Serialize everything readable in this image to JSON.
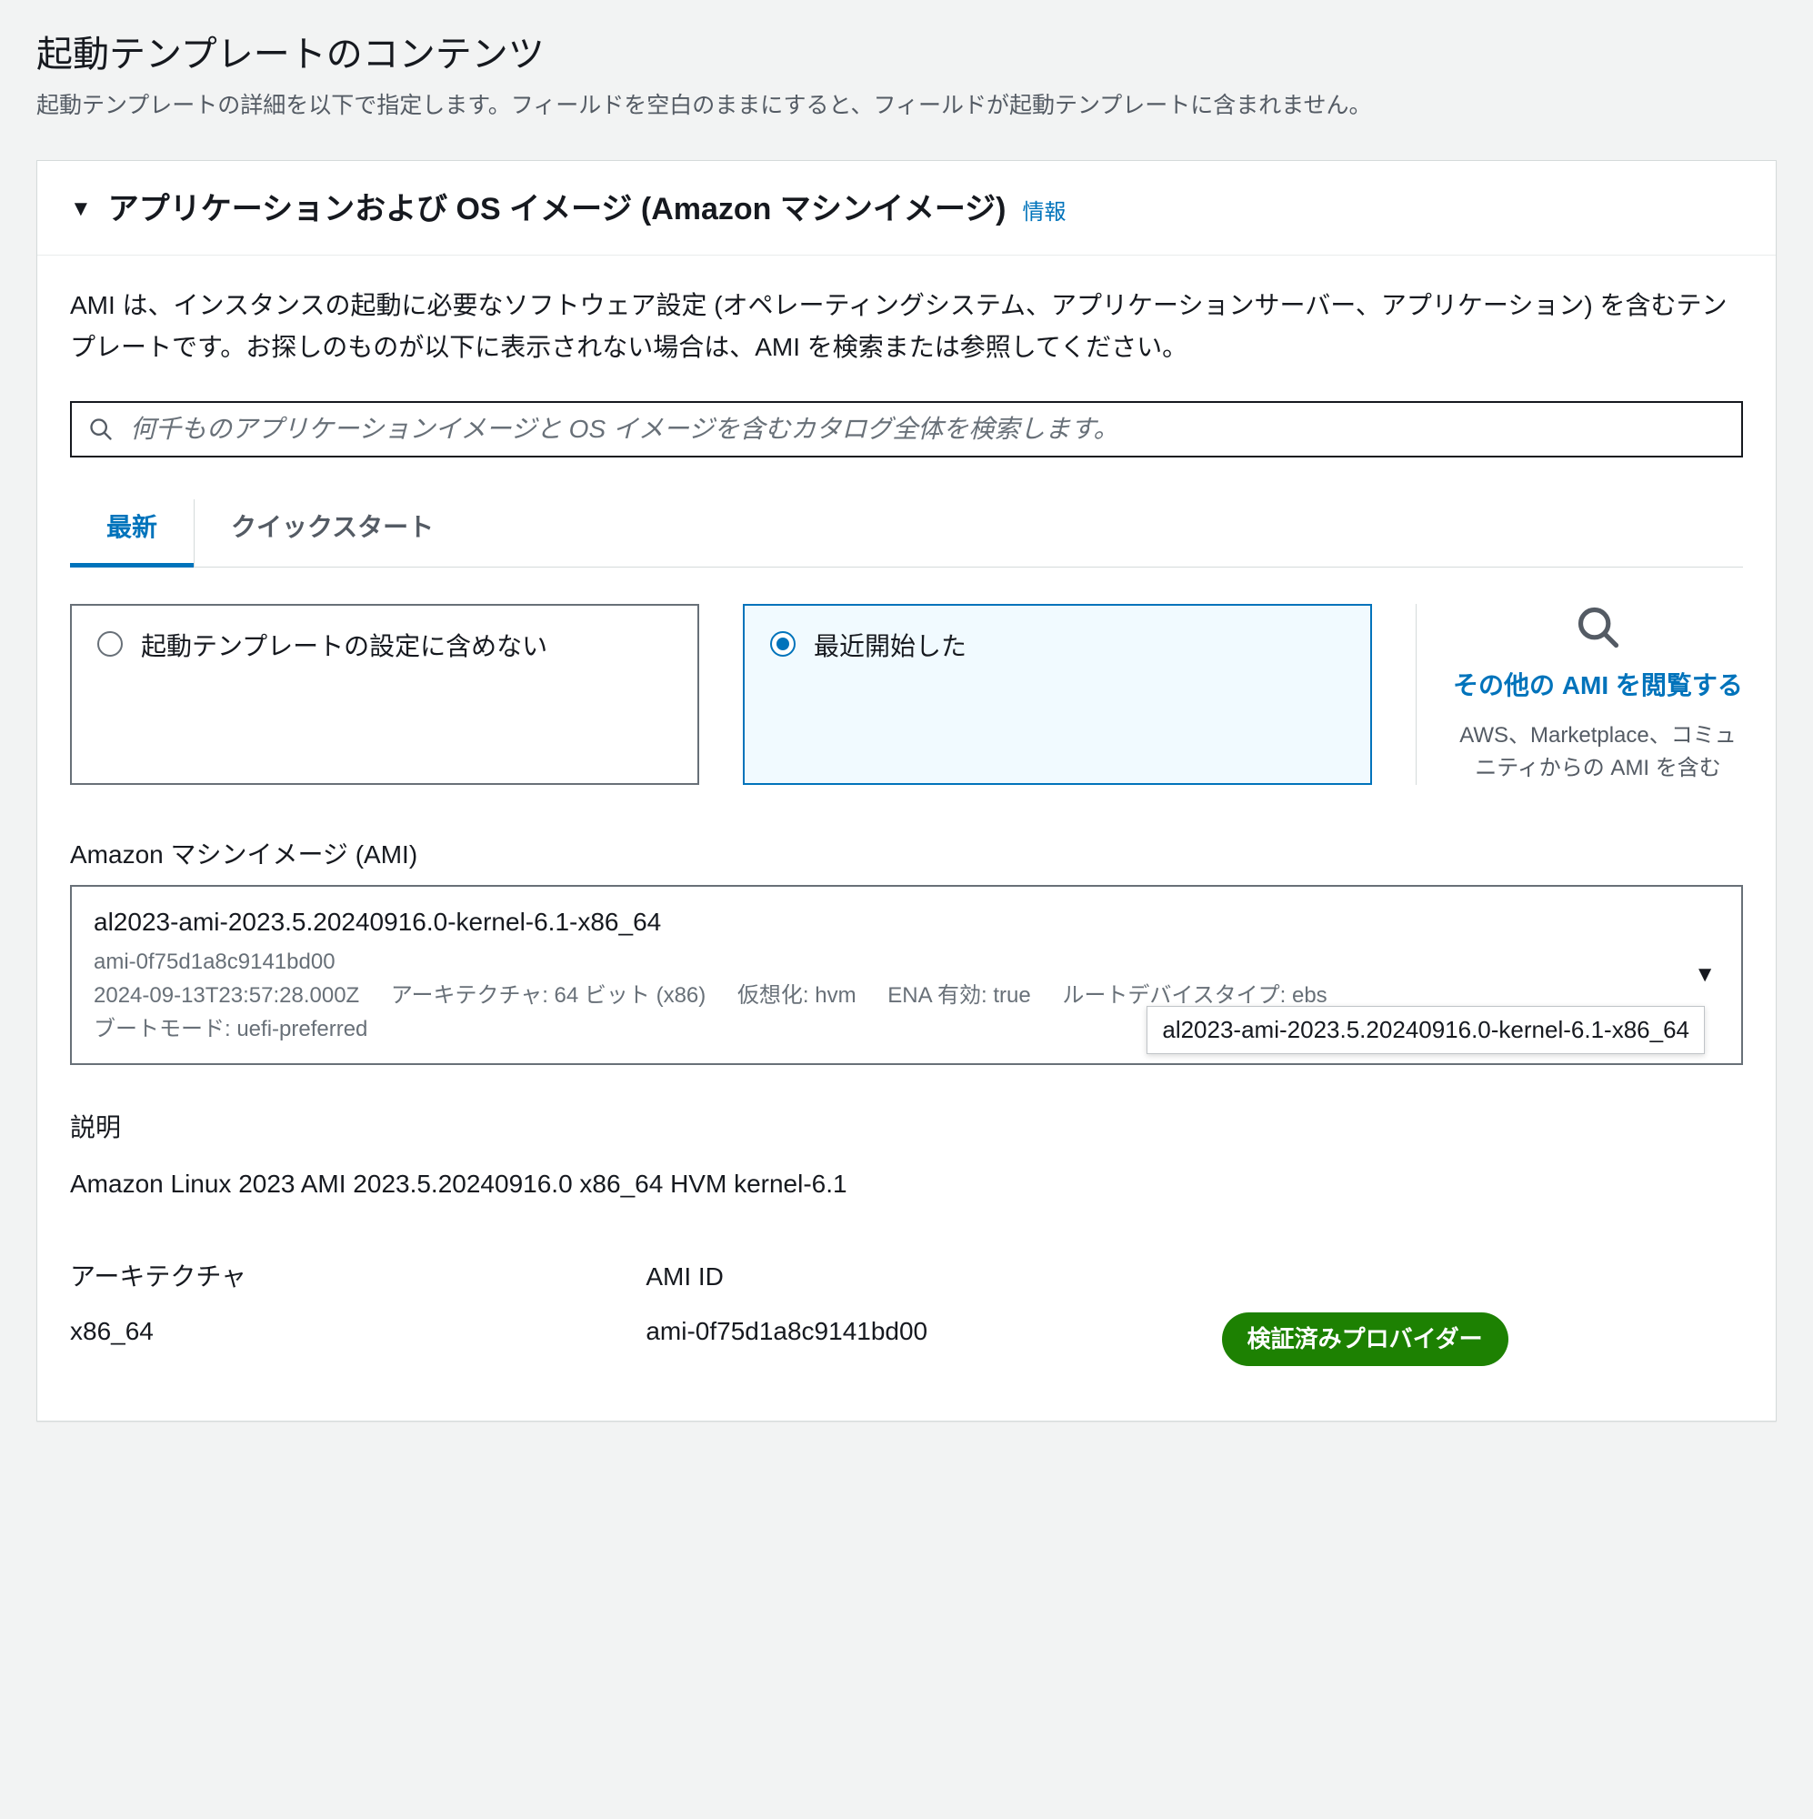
{
  "page": {
    "title": "起動テンプレートのコンテンツ",
    "subtitle": "起動テンプレートの詳細を以下で指定します。フィールドを空白のままにすると、フィールドが起動テンプレートに含まれません。"
  },
  "panel": {
    "title": "アプリケーションおよび OS イメージ (Amazon マシンイメージ)",
    "info_link": "情報",
    "description": "AMI は、インスタンスの起動に必要なソフトウェア設定 (オペレーティングシステム、アプリケーションサーバー、アプリケーション) を含むテンプレートです。お探しのものが以下に表示されない場合は、AMI を検索または参照してください。"
  },
  "search": {
    "placeholder": "何千ものアプリケーションイメージと OS イメージを含むカタログ全体を検索します。"
  },
  "tabs": {
    "recent": "最新",
    "quickstart": "クイックスタート"
  },
  "options": {
    "exclude": "起動テンプレートの設定に含めない",
    "recent": "最近開始した"
  },
  "browse": {
    "link": "その他の AMI を閲覧する",
    "sub": "AWS、Marketplace、コミュニティからの AMI を含む"
  },
  "ami": {
    "field_label": "Amazon マシンイメージ (AMI)",
    "name": "al2023-ami-2023.5.20240916.0-kernel-6.1-x86_64",
    "id_line": "ami-0f75d1a8c9141bd00",
    "date": "2024-09-13T23:57:28.000Z",
    "arch_piece": "アーキテクチャ: 64 ビット (x86)",
    "virt_piece": "仮想化: hvm",
    "ena_piece": "ENA 有効: true",
    "root_piece": "ルートデバイスタイプ: ebs",
    "boot_piece": "ブートモード: uefi-preferred",
    "tooltip": "al2023-ami-2023.5.20240916.0-kernel-6.1-x86_64"
  },
  "desc_block": {
    "label": "説明",
    "value": "Amazon Linux 2023 AMI 2023.5.20240916.0 x86_64 HVM kernel-6.1"
  },
  "row3": {
    "arch_label": "アーキテクチャ",
    "arch_value": "x86_64",
    "amiid_label": "AMI ID",
    "amiid_value": "ami-0f75d1a8c9141bd00",
    "badge": "検証済みプロバイダー"
  }
}
